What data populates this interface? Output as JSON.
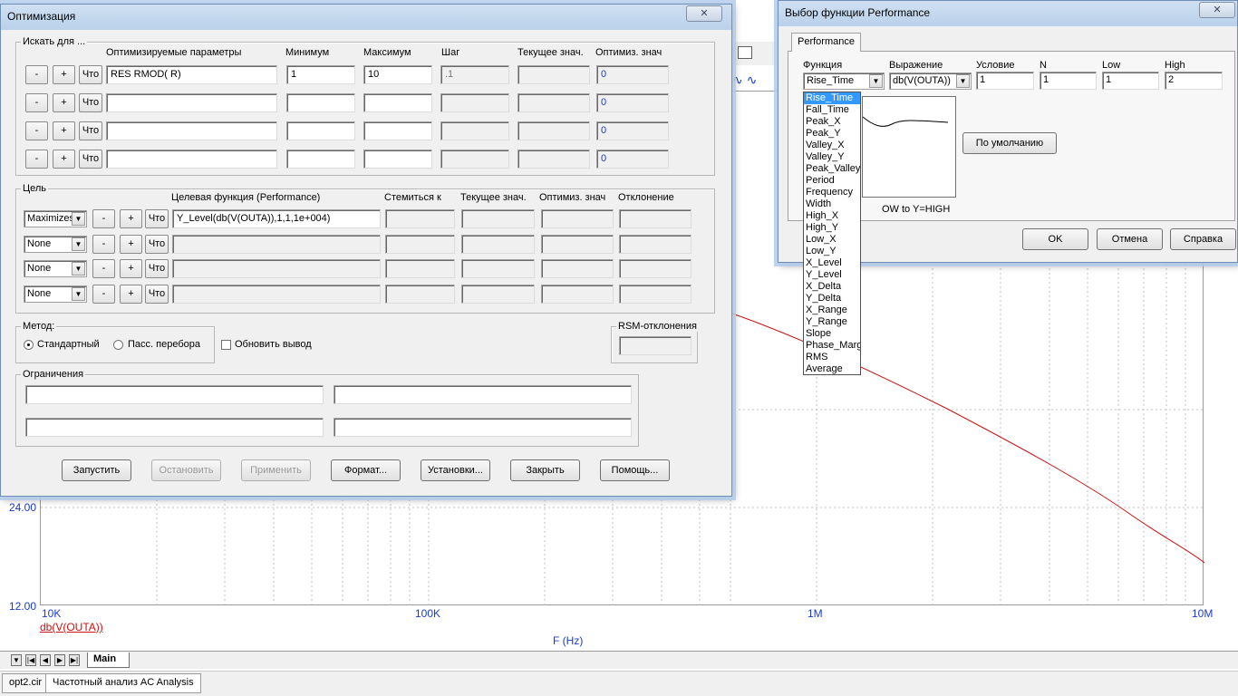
{
  "plot": {
    "y_ticks": [
      "24.00",
      "12.00"
    ],
    "x_ticks": [
      "10K",
      "100K",
      "1M",
      "10M"
    ],
    "curve_label": "db(V(OUTA))",
    "x_axis_title": "F (Hz)",
    "curve_color": "#cc1111"
  },
  "tabs": {
    "main": "Main",
    "taskbar": [
      "opt2.cir",
      "Частотный анализ AC Analysis"
    ]
  },
  "opt": {
    "title": "Оптимизация",
    "close_glyph": "✕",
    "search_group": "Искать для ...",
    "headers": {
      "params": "Оптимизируемые параметры",
      "min": "Минимум",
      "max": "Максимум",
      "step": "Шаг",
      "current": "Текущее знач.",
      "optim": "Оптимиз. знач"
    },
    "minus": "-",
    "plus": "+",
    "what": "Что",
    "param_rows": [
      {
        "param": "RES RMOD( R)",
        "min": "1",
        "max": "10",
        "step": ".1",
        "current": "",
        "optim": "0"
      },
      {
        "param": "",
        "min": "",
        "max": "",
        "step": "",
        "current": "",
        "optim": "0"
      },
      {
        "param": "",
        "min": "",
        "max": "",
        "step": "",
        "current": "",
        "optim": "0"
      },
      {
        "param": "",
        "min": "",
        "max": "",
        "step": "",
        "current": "",
        "optim": "0"
      }
    ],
    "goal_group": "Цель",
    "goal_headers": {
      "func": "Целевая функция (Performance)",
      "target": "Стемиться к",
      "current": "Текущее знач.",
      "optim": "Оптимиз. знач",
      "dev": "Отклонение"
    },
    "goal_rows": [
      {
        "mode": "Maximizes",
        "func": "Y_Level(db(V(OUTA)),1,1,1e+004)"
      },
      {
        "mode": "None",
        "func": ""
      },
      {
        "mode": "None",
        "func": ""
      },
      {
        "mode": "None",
        "func": ""
      }
    ],
    "method_group": "Метод:",
    "method_standard": "Стандартный",
    "method_pass": "Пасс. перебора",
    "update_output": "Обновить вывод",
    "rsm_group": "RSM-отклонения",
    "constraints_group": "Ограничения",
    "buttons": {
      "run": "Запустить",
      "stop": "Остановить",
      "apply": "Применить",
      "format": "Формат...",
      "settings": "Установки...",
      "close": "Закрыть",
      "help": "Помощь..."
    }
  },
  "perf": {
    "title": "Выбор функции Performance",
    "close_glyph": "✕",
    "tab": "Performance",
    "labels": {
      "func": "Функция",
      "expr": "Выражение",
      "cond": "Условие",
      "n": "N",
      "low": "Low",
      "high": "High"
    },
    "values": {
      "func": "Rise_Time",
      "expr": "db(V(OUTA))",
      "cond": "1",
      "n": "1",
      "low": "1",
      "high": "2"
    },
    "default_button": "По умолчанию",
    "description": "OW to Y=HIGH",
    "ok": "OK",
    "cancel": "Отмена",
    "help": "Справка",
    "func_list": [
      "Rise_Time",
      "Fall_Time",
      "Peak_X",
      "Peak_Y",
      "Valley_X",
      "Valley_Y",
      "Peak_Valley",
      "Period",
      "Frequency",
      "Width",
      "High_X",
      "High_Y",
      "Low_X",
      "Low_Y",
      "X_Level",
      "Y_Level",
      "X_Delta",
      "Y_Delta",
      "X_Range",
      "Y_Range",
      "Slope",
      "Phase_Margin",
      "RMS",
      "Average"
    ],
    "selected_index": 0
  }
}
